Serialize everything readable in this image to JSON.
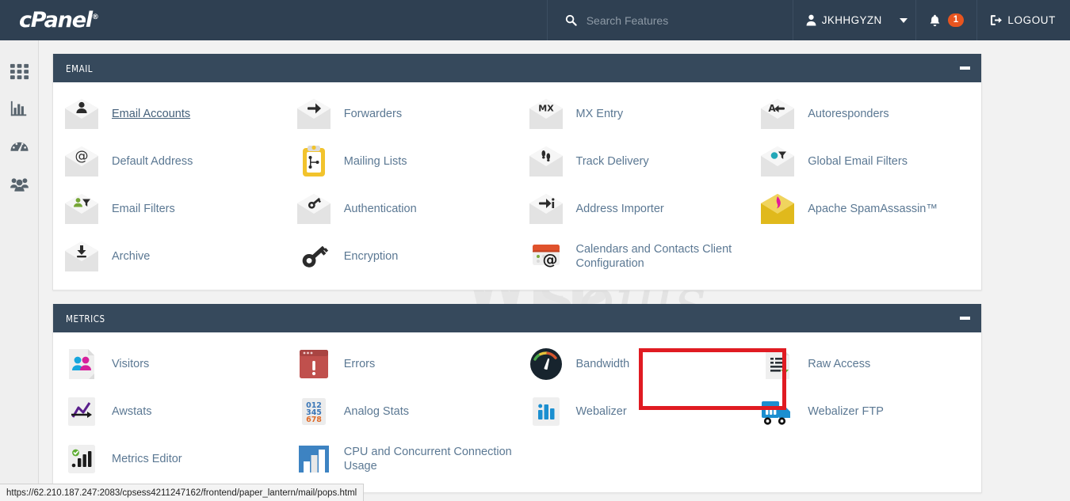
{
  "header": {
    "logo_text": "cPanel",
    "logo_tm": "®",
    "search": {
      "placeholder": "Search Features",
      "value": "",
      "icon": "search-icon"
    },
    "user": {
      "name": "JKHHGYZN",
      "icon": "user-icon",
      "caret": "chevron-down-icon"
    },
    "notifications": {
      "icon": "bell-icon",
      "count": "1",
      "badge_color": "#e8551f"
    },
    "logout": {
      "label": "LOGOUT",
      "icon": "logout-icon"
    },
    "background_color": "#2f4052"
  },
  "sidebar": {
    "items": [
      {
        "name": "apps-grid-icon",
        "label": "Home"
      },
      {
        "name": "bar-chart-icon",
        "label": "Statistics"
      },
      {
        "name": "gauge-icon",
        "label": "Dashboard"
      },
      {
        "name": "users-icon",
        "label": "User Manager"
      }
    ]
  },
  "watermark": {
    "text_primary": "WEB",
    "text_secondary": "Souls"
  },
  "panels": [
    {
      "title": "EMAIL",
      "collapse_label": "−",
      "tiles": [
        {
          "label": "Email Accounts",
          "icon": "envelope-user-icon",
          "hovered": true
        },
        {
          "label": "Forwarders",
          "icon": "envelope-arrow-icon",
          "hovered": false
        },
        {
          "label": "MX Entry",
          "icon": "envelope-mx-icon",
          "hovered": false
        },
        {
          "label": "Autoresponders",
          "icon": "envelope-reply-icon",
          "hovered": false
        },
        {
          "label": "Default Address",
          "icon": "envelope-at-icon",
          "hovered": false
        },
        {
          "label": "Mailing Lists",
          "icon": "clipboard-list-icon",
          "hovered": false
        },
        {
          "label": "Track Delivery",
          "icon": "envelope-footprints-icon",
          "hovered": false
        },
        {
          "label": "Global Email Filters",
          "icon": "envelope-filter-icon",
          "hovered": false
        },
        {
          "label": "Email Filters",
          "icon": "envelope-user-filter-icon",
          "hovered": false
        },
        {
          "label": "Authentication",
          "icon": "envelope-key-icon",
          "hovered": false
        },
        {
          "label": "Address Importer",
          "icon": "envelope-import-icon",
          "hovered": false
        },
        {
          "label": "Apache SpamAssassin™",
          "icon": "envelope-spam-icon",
          "hovered": false
        },
        {
          "label": "Archive",
          "icon": "envelope-download-icon",
          "hovered": false
        },
        {
          "label": "Encryption",
          "icon": "key-icon",
          "hovered": false
        },
        {
          "label": "Calendars and Contacts Client Configuration",
          "icon": "calendar-at-icon",
          "hovered": false
        }
      ]
    },
    {
      "title": "METRICS",
      "collapse_label": "−",
      "tiles": [
        {
          "label": "Visitors",
          "icon": "visitors-icon",
          "hovered": false
        },
        {
          "label": "Errors",
          "icon": "errors-icon",
          "hovered": false
        },
        {
          "label": "Bandwidth",
          "icon": "bandwidth-gauge-icon",
          "hovered": false
        },
        {
          "label": "Raw Access",
          "icon": "raw-access-icon",
          "hovered": false,
          "highlighted": true
        },
        {
          "label": "Awstats",
          "icon": "awstats-icon",
          "hovered": false
        },
        {
          "label": "Analog Stats",
          "icon": "analog-stats-icon",
          "hovered": false
        },
        {
          "label": "Webalizer",
          "icon": "webalizer-icon",
          "hovered": false
        },
        {
          "label": "Webalizer FTP",
          "icon": "webalizer-ftp-icon",
          "hovered": false
        },
        {
          "label": "Metrics Editor",
          "icon": "metrics-editor-icon",
          "hovered": false
        },
        {
          "label": "CPU and Concurrent Connection Usage",
          "icon": "cpu-usage-icon",
          "hovered": false
        }
      ]
    }
  ],
  "highlight": {
    "color": "#e01b22",
    "target": "Raw Access"
  },
  "status_bar": {
    "url": "https://62.210.187.247:2083/cpsess4211247162/frontend/paper_lantern/mail/pops.html"
  }
}
